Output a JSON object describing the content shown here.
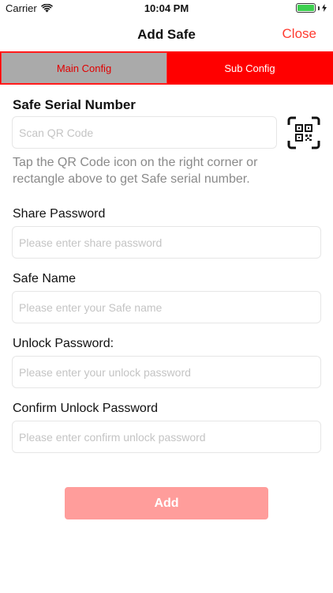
{
  "status_bar": {
    "carrier": "Carrier",
    "time": "10:04 PM",
    "battery_level": 1.0,
    "battery_color": "#3ccf4e"
  },
  "nav": {
    "title": "Add Safe",
    "close_label": "Close",
    "accent_color": "#ff3b30"
  },
  "segments": {
    "main_label": "Main Config",
    "sub_label": "Sub Config",
    "selected": "Main Config"
  },
  "form": {
    "serial_label": "Safe Serial Number",
    "serial_placeholder": "Scan QR Code",
    "serial_value": "",
    "qr_icon": "qr-code-scan-icon",
    "hint": "Tap the QR Code icon on the right corner or rectangle above to get Safe serial number.",
    "share_label": "Share Password",
    "share_placeholder": "Please enter share password",
    "share_value": "",
    "name_label": "Safe Name",
    "name_placeholder": "Please enter your Safe name",
    "name_value": "",
    "unlock_label": "Unlock Password:",
    "unlock_placeholder": "Please enter your unlock password",
    "unlock_value": "",
    "confirm_label": "Confirm Unlock Password",
    "confirm_placeholder": "Please enter confirm unlock password",
    "confirm_value": ""
  },
  "add_button": {
    "label": "Add",
    "color": "#ff9d9b"
  }
}
